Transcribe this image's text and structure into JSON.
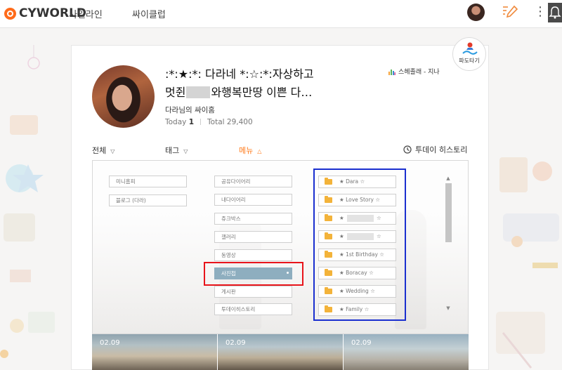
{
  "header": {
    "logo_text": "CYWORLD",
    "nav": [
      "사일라인",
      "싸이클럽"
    ]
  },
  "profile": {
    "title_line1": ":*:★:*: 다라네 *:☆:*:자상하고",
    "title_line2_a": "멋쥔",
    "title_line2_b": "와행복만땅 이쁜 다…",
    "music": "스헤졸래 - 지나",
    "owner": "다라님의 싸이홈",
    "today_label": "Today",
    "today_value": "1",
    "total_label": "Total",
    "total_value": "29,400",
    "badge_label": "파도타기"
  },
  "filters": {
    "all": "전체",
    "tag": "태그",
    "menu": "메뉴",
    "history": "투데이 히스토리"
  },
  "menu": {
    "col1": [
      "미니홈피",
      "블로그 (다라)"
    ],
    "col2": [
      "공유다이어리",
      "내다이어리",
      "쥬크박스",
      "갤러리",
      "동영상",
      "사진첩",
      "게시판",
      "투데이히스토리"
    ],
    "active": "사진첩",
    "folders": [
      {
        "label": "★ Dara ☆"
      },
      {
        "label": "★ Love Story ☆"
      },
      {
        "label": "★",
        "tail": "☆",
        "redacted": true
      },
      {
        "label": "★",
        "tail": "☆",
        "redacted": true
      },
      {
        "label": "★ 1st Birthday ☆"
      },
      {
        "label": "★ Boracay ☆"
      },
      {
        "label": "★ Wedding ☆"
      },
      {
        "label": "★ Family ☆"
      }
    ]
  },
  "photos": [
    {
      "date": "02.09"
    },
    {
      "date": "02.09"
    },
    {
      "date": "02.09"
    }
  ],
  "colors": {
    "accent": "#ff7a1a",
    "active_menu": "#8eaebf",
    "folder": "#f3b33a",
    "highlight_red": "#e8141b",
    "highlight_blue": "#1a2fcf"
  },
  "icons": [
    "cyworld-logo-icon",
    "profile-avatar-icon",
    "pencil-icon",
    "more-icon",
    "bell-icon",
    "music-icon",
    "clock-icon",
    "folder-icon",
    "chevron-down-icon",
    "chevron-up-icon"
  ]
}
